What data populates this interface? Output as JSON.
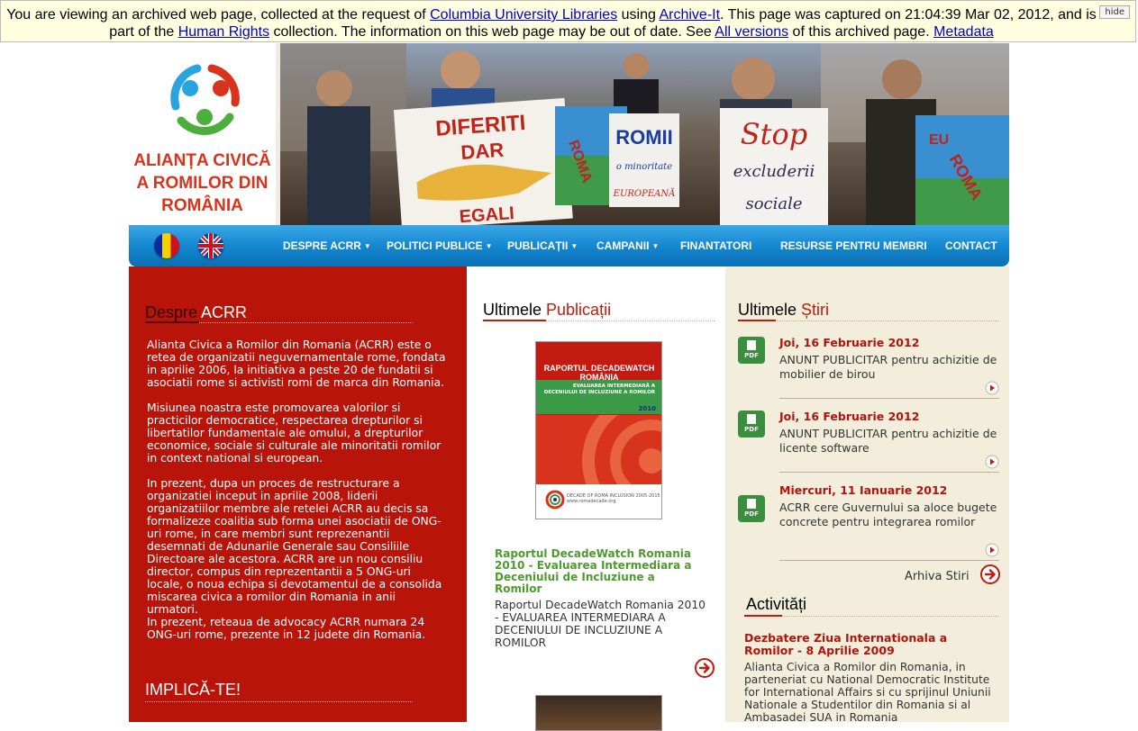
{
  "archive_banner": {
    "text_1": "You are viewing an archived web page, collected at the request of ",
    "link_columbia": "Columbia University Libraries",
    "text_2": " using ",
    "link_archiveit": "Archive-It",
    "text_3": ". This page was captured on 21:04:39 Mar 02, 2012, and is part of the ",
    "link_collection": "Human Rights",
    "text_4": " collection. The information on this web page may be out of date. See ",
    "link_versions": "All versions",
    "text_5": " of this archived page. ",
    "link_metadata": "Metadata",
    "hide_label": "hide"
  },
  "logo": {
    "line1": "ALIANȚA CIVICĂ",
    "line2": "A ROMILOR DIN",
    "line3": "ROMÂNIA",
    "colors": [
      "#2aa4de",
      "#d8331c",
      "#4cae3c"
    ]
  },
  "hero": {
    "sign_1_line1": "DIFERITI",
    "sign_1_line2": "DAR",
    "sign_1_line3": "EGALI",
    "sign_2_line1": "ROMII",
    "sign_2_line2": "o minoritate",
    "sign_2_line3": "EUROPEANĂ",
    "sign_3_line1": "Stop",
    "sign_3_line2": "excluderii",
    "sign_3_line3": "sociale",
    "sign_4_line1": "EU",
    "sign_4_line2": "ROMA",
    "flag_word": "ROMA"
  },
  "nav": {
    "items": [
      {
        "label": "DESPRE ACRR",
        "dropdown": true
      },
      {
        "label": "POLITICI PUBLICE",
        "dropdown": true
      },
      {
        "label": "PUBLICAȚII",
        "dropdown": true
      },
      {
        "label": "CAMPANII",
        "dropdown": true
      },
      {
        "label": "FINANTATORI",
        "dropdown": false
      },
      {
        "label": "RESURSE PENTRU MEMBRI",
        "dropdown": false
      },
      {
        "label": "CONTACT",
        "dropdown": false
      }
    ],
    "caret": "▼",
    "languages": [
      "ro-flag-icon",
      "uk-flag-icon"
    ]
  },
  "despre": {
    "title_word1": "Despre",
    "title_word2": "ACRR",
    "p1": "Alianta Civica a Romilor din Romania (ACRR) este o retea de organizatii neguvernamentale rome, fondata in aprilie 2006, la initiativa a peste 20 de fundatii si asociatii rome si activisti romi de marca din Romania.",
    "p2": "Misiunea noastra este promovarea valorilor si practicilor democratice, respectarea drepturilor si libertatilor fundamentale ale omului, a drepturilor economice, sociale si culturale ale minoritatii romilor in context national si european.",
    "p3": "In prezent, dupa un proces de restructurare a organizatiei inceput in aprilie 2008, liderii organizatiilor membre ale retelei ACRR au decis sa formalizeze coalitia sub forma unei asociatii de ONG-uri rome, in care membri sunt reprezenantii desemnati de Adunarile Generale sau Consiliile Directoare ale acestora. ACRR are un nou consiliu director, compus din reprezentantii a 5 ONG-uri locale, o noua echipa si devotamentul de a consolida miscarea civica a romilor din Romania in anii urmatori.",
    "p4": "In prezent, reteaua de advocacy ACRR numara 24 ONG-uri rome, prezente in 12 judete din Romania.",
    "implica_title": "IMPLICĂ-TE!"
  },
  "publicatii": {
    "title_word1": "Ultimele",
    "title_word2": "Publicații",
    "cover_title": "RAPORTUL DECADEWATCH ROMÂNIA",
    "cover_sub": "EVALUAREA INTERMEDIARĂ A DECENIULUI DE INCLUZIUNE A ROMILOR",
    "cover_year": "2010",
    "cover_footer": "DECADE OF ROMA INCLUSION 2005-2015 www.romadecade.org",
    "item_title": "Raportul DecadeWatch Romania 2010 - Evaluarea Intermediara a Deceniului de Incluziune a Romilor",
    "item_desc": "Raportul DecadeWatch Romania 2010 - EVALUAREA INTERMEDIARA A DECENIULUI DE INCLUZIUNE A ROMILOR"
  },
  "stiri": {
    "title_word1": "Ultimele",
    "title_word2": "Știri",
    "items": [
      {
        "date": "Joi, 16 Februarie 2012",
        "text": "ANUNT PUBLICITAR pentru achizitie de mobilier de birou",
        "icon_label": "PDF"
      },
      {
        "date": "Joi, 16 Februarie 2012",
        "text": "ANUNT PUBLICITAR pentru achizitie de licente software",
        "icon_label": "PDF"
      },
      {
        "date": "Miercuri, 11 Ianuarie 2012",
        "text": "ACRR cere Guvernului sa aloce bugete concrete pentru integrarea romilor",
        "icon_label": "PDF"
      }
    ],
    "archive_label": "Arhiva Stiri"
  },
  "activitati": {
    "title": "Activități",
    "item_title": "Dezbatere Ziua Internationala a Romilor - 8 Aprilie 2009",
    "item_body": "Alianta Civica a Romilor din Romania, in parteneriat cu National Democratic Institute for International Affairs si cu sprijinul Uniunii Nationale a Studentilor din Romania si al Ambasadei SUA in Romania"
  },
  "colors": {
    "brand_red": "#b9140a",
    "nav_blue": "#1285cf",
    "cream": "#f3eedc",
    "link_green": "#4d9a2f"
  }
}
